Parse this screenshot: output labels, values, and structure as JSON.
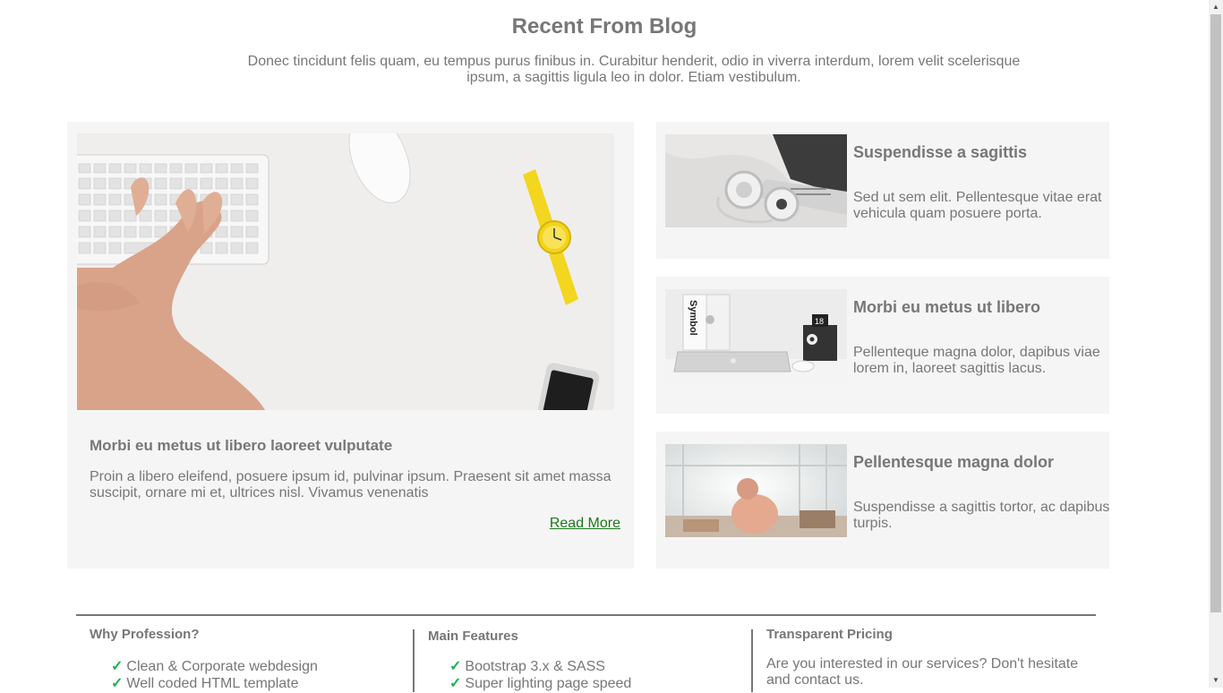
{
  "blog": {
    "title": "Recent From Blog",
    "subtitle": "Donec tincidunt felis quam, eu tempus purus finibus in. Curabitur henderit, odio in viverra interdum, lorem velit scelerisque ipsum, a sagittis ligula leo in dolor. Etiam vestibulum.",
    "featured": {
      "title": "Morbi eu metus ut libero laoreet vulputate",
      "text": "Proin a libero eleifend, posuere ipsum id, pulvinar ipsum. Praesent sit amet massa suscipit, ornare mi et, ultrices nisl. Vivamus venenatis",
      "read_more": "Read More"
    },
    "posts": [
      {
        "title": "Suspendisse a sagittis",
        "text": "Sed ut sem elit. Pellentesque vitae erat vehicula quam posuere porta."
      },
      {
        "title": "Morbi eu metus ut libero",
        "text": "Pellenteque magna dolor, dapibus viae lorem in, laoreet sagittis lacus."
      },
      {
        "title": "Pellentesque magna dolor",
        "text": "Suspendisse a sagittis tortor, ac dapibus turpis."
      }
    ]
  },
  "footer": {
    "why": {
      "title": "Why Profession?",
      "items": [
        "Clean & Corporate webdesign",
        "Well coded HTML template"
      ]
    },
    "features": {
      "title": "Main Features",
      "items": [
        "Bootstrap 3.x & SASS",
        "Super lighting page speed"
      ]
    },
    "pricing": {
      "title": "Transparent Pricing",
      "text": "Are you interested in our services? Don't hesitate and contact us."
    },
    "check_glyph": "✓"
  },
  "colors": {
    "accent": "#1a7a1a",
    "check": "#22b14c",
    "card_bg": "#f5f5f5",
    "text": "#777777"
  }
}
